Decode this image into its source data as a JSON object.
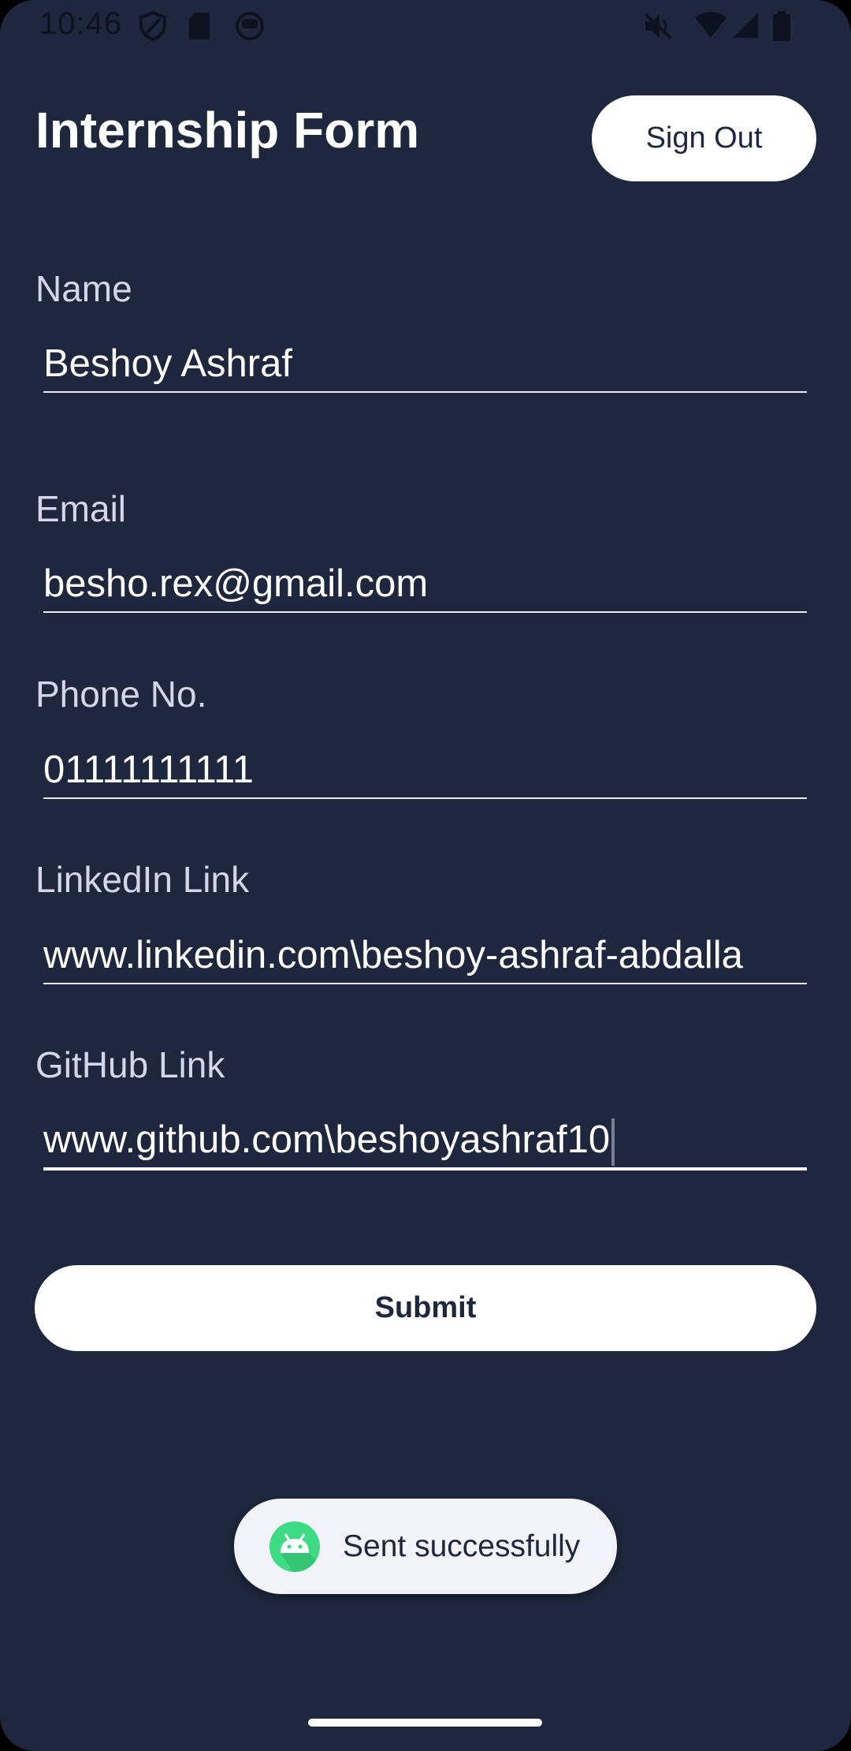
{
  "status_bar": {
    "time": "10:46"
  },
  "header": {
    "title": "Internship Form",
    "sign_out_label": "Sign Out"
  },
  "form": {
    "fields": [
      {
        "label": "Name",
        "value": "Beshoy Ashraf"
      },
      {
        "label": "Email",
        "value": "besho.rex@gmail.com"
      },
      {
        "label": "Phone No.",
        "value": "01111111111"
      },
      {
        "label": "LinkedIn Link",
        "value": "www.linkedin.com\\beshoy-ashraf-abdalla"
      },
      {
        "label": "GitHub Link",
        "value": "www.github.com\\beshoyashraf10"
      }
    ],
    "submit_label": "Submit"
  },
  "toast": {
    "message": "Sent successfully"
  },
  "colors": {
    "background": "#1f273e",
    "button": "#ffffff",
    "label": "#d4d6ea",
    "toast_bg": "#f1f3f8",
    "android_green": "#3ddc84"
  }
}
